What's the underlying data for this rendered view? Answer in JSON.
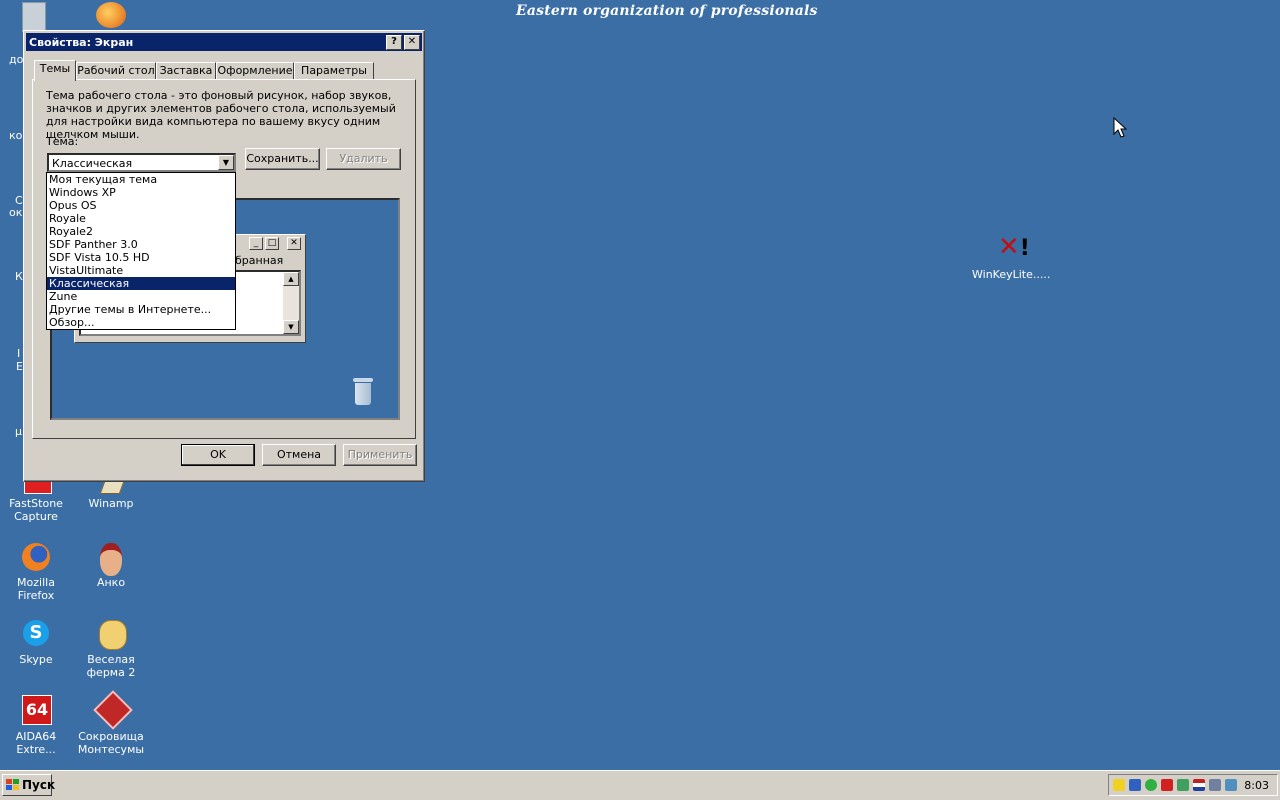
{
  "desktop": {
    "banner": "Eastern organization of professionals",
    "edge_fragments": [
      "до",
      "ком",
      "С",
      "окр",
      "К",
      "І",
      "Е",
      "µ"
    ],
    "icons": [
      {
        "id": "faststone",
        "label": "FastStone Capture",
        "icon": "faststone-icon"
      },
      {
        "id": "winamp",
        "label": "Winamp",
        "icon": "winamp-icon"
      },
      {
        "id": "firefox",
        "label": "Mozilla Firefox",
        "icon": "firefox-icon"
      },
      {
        "id": "anko",
        "label": "Анко",
        "icon": "anko-icon"
      },
      {
        "id": "skype",
        "label": "Skype",
        "icon": "skype-icon"
      },
      {
        "id": "farm",
        "label": "Веселая ферма 2",
        "icon": "farm-duck-icon"
      },
      {
        "id": "aida",
        "label": "AIDA64 Extre...",
        "icon": "aida64-icon",
        "badge": "64"
      },
      {
        "id": "treasure",
        "label": "Сокровища Монтесумы",
        "icon": "montezuma-icon"
      },
      {
        "id": "winkey",
        "label": "WinKeyLite.....",
        "icon": "winkey-icon"
      }
    ]
  },
  "dialog": {
    "title": "Свойства: Экран",
    "help_button": "?",
    "close_button": "✕",
    "tabs": [
      "Темы",
      "Рабочий стол",
      "Заставка",
      "Оформление",
      "Параметры"
    ],
    "description": "Тема рабочего стола - это фоновый рисунок, набор звуков, значков и других элементов рабочего стола, используемый для настройки вида компьютера по вашему вкусу одним щелчком мыши.",
    "theme_label": "Тема:",
    "theme_value": "Классическая",
    "save_button": "Сохранить...",
    "delete_button": "Удалить",
    "dropdown_options": [
      "Моя текущая тема",
      "Windows XP",
      "Opus OS",
      "Royale",
      "Royale2",
      "SDF Panther 3.0",
      "SDF Vista 10.5 HD",
      "VistaUltimate",
      "Классическая",
      "Zune",
      "Другие темы в Интернете...",
      "Обзор..."
    ],
    "selected_index": 8,
    "preview": {
      "window_text": "бранная"
    },
    "ok_button": "OK",
    "cancel_button": "Отмена",
    "apply_button": "Применить"
  },
  "taskbar": {
    "start_label": "Пуск",
    "clock": "8:03",
    "tray_icons": [
      "shield-icon",
      "network-icon",
      "security-check-icon",
      "antivirus-icon",
      "volume-icon",
      "language-flag-icon",
      "device-icon",
      "app-icon"
    ]
  }
}
